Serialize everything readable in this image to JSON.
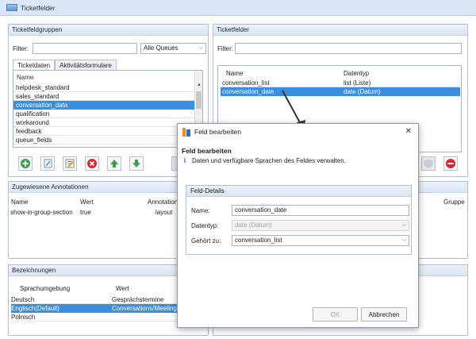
{
  "window": {
    "title": "Ticketfelder"
  },
  "groups_panel": {
    "header": "Ticketfeldgruppen",
    "filter_label": "Filter:",
    "queue_select": "Alle Queues",
    "tabs": [
      {
        "label": "Ticketdaten"
      },
      {
        "label": "Aktivitätsformulare"
      }
    ],
    "list_header": "Name",
    "items": [
      "helpdesk_standard",
      "sales_standard",
      "conversation_data",
      "qualification",
      "workaround",
      "feedback",
      "queue_fields"
    ],
    "selected_index": 2
  },
  "fields_panel": {
    "header": "Ticketfelder",
    "filter_label": "Filter:",
    "columns": [
      "Name",
      "Datentyp"
    ],
    "rows": [
      {
        "name": "conversation_list",
        "type": "list (Liste)"
      },
      {
        "name": "conversation_date",
        "type": "date (Datum)"
      }
    ],
    "selected_index": 1,
    "peek_column": "Gruppe"
  },
  "annotations_panel": {
    "header": "Zugewiesene Annotationen",
    "columns": [
      "Name",
      "Wert",
      "Annotation"
    ],
    "rows": [
      {
        "name": "show-in-group-section",
        "value": "true",
        "annotation": "layout"
      }
    ]
  },
  "labels_panel": {
    "header": "Bezeichnungen",
    "columns": [
      "Sprachumgebung",
      "Wert"
    ],
    "rows": [
      {
        "locale": "Deutsch",
        "value": "Gesprächstermine"
      },
      {
        "locale": "Englisch(Default)",
        "value": "Conversations/Meetings"
      },
      {
        "locale": "Polnisch",
        "value": ""
      }
    ],
    "selected_index": 1
  },
  "dialog": {
    "title": "Feld bearbeiten",
    "heading": "Feld bearbeiten",
    "info": "Daten und verfügbare Sprachen des Feldes verwalten.",
    "group_header": "Feld-Details",
    "name_label": "Name:",
    "name_value": "conversation_date",
    "type_label": "Datentyp:",
    "type_value": "date (Datum)",
    "belongs_label": "Gehört zu:",
    "belongs_value": "conversation_list",
    "ok_label": "OK",
    "cancel_label": "Abbrechen"
  },
  "colors": {
    "selection": "#3a8ee0",
    "header": "#dbe6f3",
    "add": "#3aa14a",
    "delete": "#d8262f",
    "move": "#3aa14a"
  }
}
